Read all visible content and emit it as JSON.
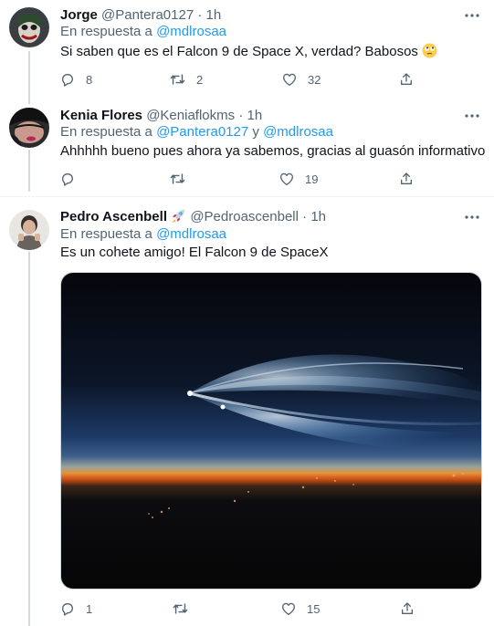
{
  "tweets": [
    {
      "name": "Jorge",
      "handle": "@Pantera0127",
      "dot": "·",
      "time": "1h",
      "reply_prefix": "En respuesta a",
      "reply_mention_1": "@mdlrosaa",
      "text": "Si saben que es el Falcon 9 de Space X, verdad? Babosos",
      "emoji": "face-with-rolling-eyes",
      "replies": "8",
      "retweets": "2",
      "likes": "32"
    },
    {
      "name": "Kenia Flores",
      "handle": "@Keniaflokms",
      "dot": "·",
      "time": "1h",
      "reply_prefix": "En respuesta a",
      "reply_mention_1": "@Pantera0127",
      "reply_joiner": "y",
      "reply_mention_2": "@mdlrosaa",
      "text": "Ahhhhh bueno pues ahora ya sabemos, gracias al guasón informativo",
      "replies": "",
      "retweets": "",
      "likes": "19"
    },
    {
      "name": "Pedro Ascenbell",
      "name_emoji": "rocket",
      "handle": "@Pedroascenbell",
      "dot": "·",
      "time": "1h",
      "reply_prefix": "En respuesta a",
      "reply_mention_1": "@mdlrosaa",
      "text": "Es un cohete amigo! El Falcon 9 de SpaceX",
      "media": "night-sky-rocket-plume-photo",
      "replies": "1",
      "retweets": "",
      "likes": "15"
    }
  ],
  "colors": {
    "text": "#0f1419",
    "secondary": "#536471",
    "link": "#1d9bf0",
    "divider": "#eff3f4",
    "thread_line": "#cfd9de"
  },
  "icons": [
    "more-icon",
    "reply-icon",
    "retweet-icon",
    "like-icon",
    "share-icon"
  ]
}
